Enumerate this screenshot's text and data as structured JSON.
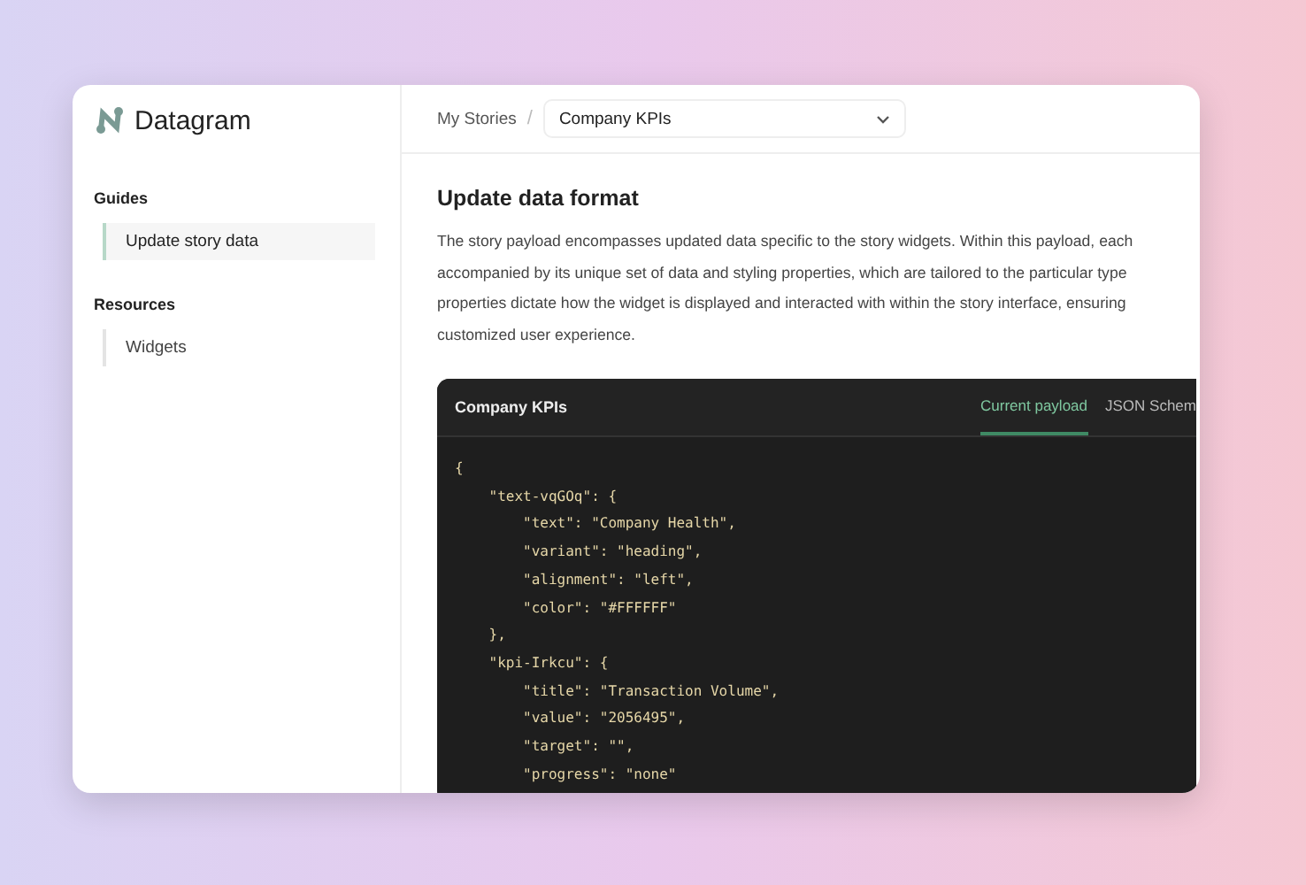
{
  "brand": {
    "name": "Datagram"
  },
  "sidebar": {
    "sections": [
      {
        "heading": "Guides",
        "items": [
          {
            "label": "Update story data",
            "selected": true
          }
        ]
      },
      {
        "heading": "Resources",
        "items": [
          {
            "label": "Widgets",
            "selected": false
          }
        ]
      }
    ]
  },
  "breadcrumb": {
    "parent": "My Stories",
    "separator": "/",
    "select_value": "Company KPIs"
  },
  "article": {
    "title": "Update data format",
    "paragraph_lines": [
      "The story payload encompasses updated data specific to the story widgets. Within this payload, each",
      "accompanied by its unique set of data and styling properties, which are tailored to the particular type",
      "properties dictate how the widget is displayed and interacted with within the story interface, ensuring",
      "customized user experience."
    ]
  },
  "code_panel": {
    "title": "Company KPIs",
    "tabs": [
      {
        "label": "Current payload",
        "selected": true
      },
      {
        "label": "JSON Schem",
        "selected": false
      }
    ],
    "lines": [
      "{",
      "    \"text-vqGOq\": {",
      "        \"text\": \"Company Health\",",
      "        \"variant\": \"heading\",",
      "        \"alignment\": \"left\",",
      "        \"color\": \"#FFFFFF\"",
      "    },",
      "    \"kpi-Irkcu\": {",
      "        \"title\": \"Transaction Volume\",",
      "        \"value\": \"2056495\",",
      "        \"target\": \"\",",
      "        \"progress\": \"none\""
    ]
  }
}
